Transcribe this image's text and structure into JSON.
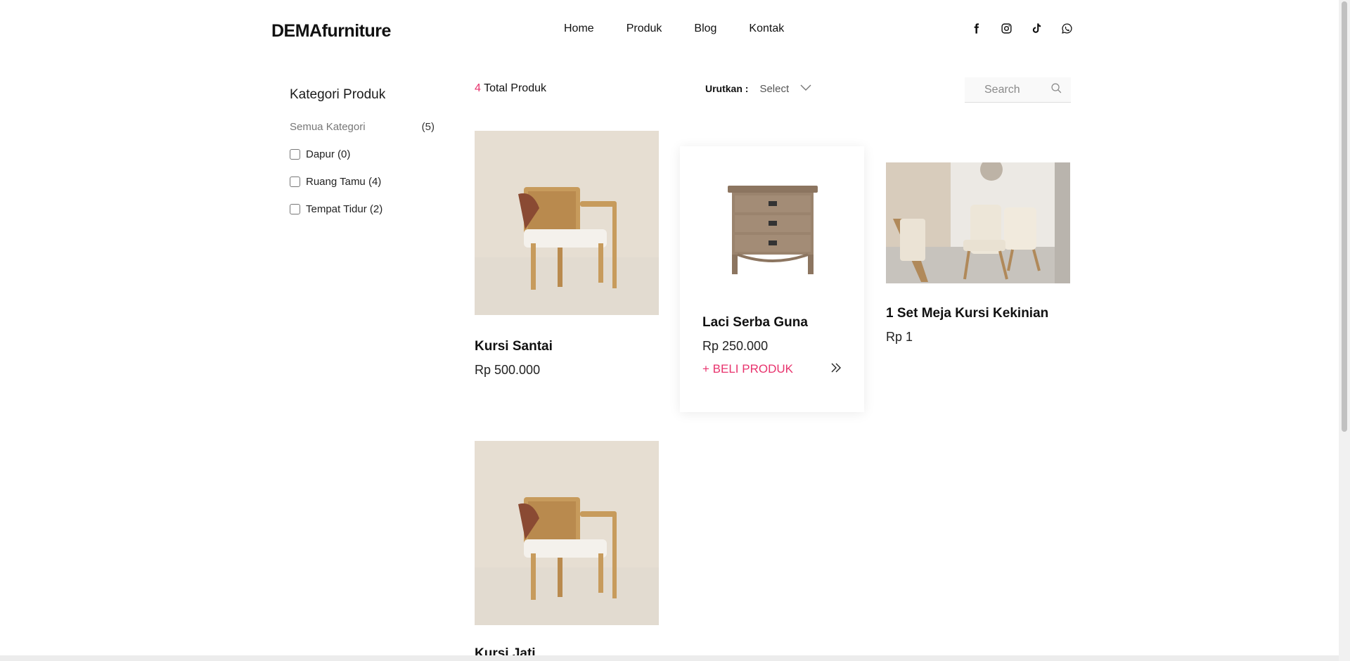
{
  "brand": {
    "logo": "DEMAfurniture"
  },
  "nav": {
    "items": [
      "Home",
      "Produk",
      "Blog",
      "Kontak"
    ]
  },
  "socials": [
    "facebook-icon",
    "instagram-icon",
    "tiktok-icon",
    "whatsapp-icon"
  ],
  "sidebar": {
    "title": "Kategori Produk",
    "all": {
      "label": "Semua Kategori",
      "count": "(5)"
    },
    "categories": [
      {
        "label": "Dapur (0)",
        "checked": false
      },
      {
        "label": "Ruang Tamu (4)",
        "checked": false
      },
      {
        "label": "Tempat Tidur (2)",
        "checked": false
      }
    ]
  },
  "toolbar": {
    "total_count": "4",
    "total_label": "Total Produk",
    "sort_label": "Urutkan :",
    "sort_value": "Select",
    "search_placeholder": "Search"
  },
  "products": [
    {
      "name": "Kursi Santai",
      "price": "Rp 500.000",
      "image": "rattan-chair"
    },
    {
      "name": "Laci Serba Guna",
      "price": "Rp 250.000",
      "image": "wooden-drawer",
      "action": "+ BELI PRODUK"
    },
    {
      "name": "1 Set Meja Kursi Kekinian",
      "price": "Rp 1",
      "image": "lounge-set"
    },
    {
      "name": "Kursi Jati",
      "price": "",
      "image": "rattan-chair"
    }
  ],
  "colors": {
    "accent": "#e8336d",
    "text": "#111111",
    "muted": "#777777"
  }
}
